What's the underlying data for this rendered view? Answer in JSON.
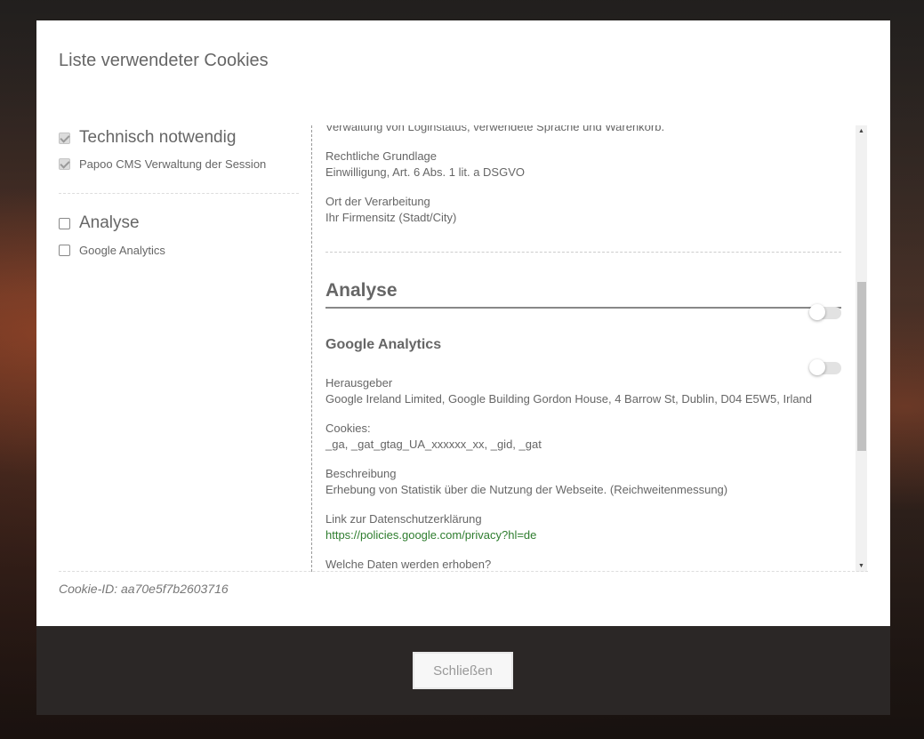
{
  "modal": {
    "title": "Liste verwendeter Cookies",
    "cookie_id": "Cookie-ID: aa70e5f7b2603716"
  },
  "categories": [
    {
      "label": "Technisch notwendig",
      "checked": true,
      "services": [
        {
          "label": "Papoo CMS Verwaltung der Session",
          "checked": true
        }
      ]
    },
    {
      "label": "Analyse",
      "checked": false,
      "services": [
        {
          "label": "Google Analytics",
          "checked": false
        }
      ]
    }
  ],
  "details": {
    "cut_off_line": "Verwaltung von Loginstatus, verwendete Sprache und Warenkorb.",
    "legal_basis": {
      "label": "Rechtliche Grundlage",
      "value": "Einwilligung, Art. 6 Abs. 1 lit. a DSGVO"
    },
    "processing_location": {
      "label": "Ort der Verarbeitung",
      "value": "Ihr Firmensitz (Stadt/City)"
    },
    "section": {
      "title": "Analyse",
      "toggle_on": false
    },
    "service": {
      "title": "Google Analytics",
      "toggle_on": false,
      "publisher": {
        "label": "Herausgeber",
        "value": "Google Ireland Limited, Google Building Gordon House, 4 Barrow St, Dublin, D04 E5W5, Irland"
      },
      "cookies": {
        "label": "Cookies:",
        "value": "_ga, _gat_gtag_UA_xxxxxx_xx, _gid, _gat"
      },
      "description": {
        "label": "Beschreibung",
        "value": "Erhebung von Statistik über die Nutzung der Webseite. (Reichweitenmessung)"
      },
      "privacy_link": {
        "label": "Link zur Datenschutzerklärung",
        "value": "https://policies.google.com/privacy?hl=de"
      },
      "data_collected_label": "Welche Daten werden erhoben?"
    }
  },
  "footer": {
    "close_label": "Schließen"
  }
}
